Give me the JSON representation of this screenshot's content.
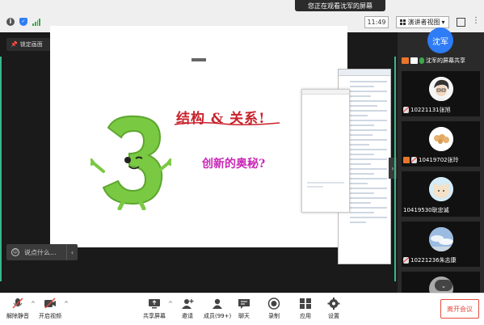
{
  "topbar": {
    "banner": "您正在观看沈军的屏幕",
    "time": "11:49",
    "view_label": "演讲者视图",
    "view_caret": "▾",
    "more": "⋮"
  },
  "main": {
    "pin_label": "锁定画面",
    "slide": {
      "title1": "结构 & 关系!",
      "title2": "创新的奥秘?"
    },
    "chat_placeholder": "说点什么...",
    "chat_arrow": "‹",
    "collapse_arrow": "›"
  },
  "participants": {
    "host_avatar_text": "沈军",
    "share_label": "沈军的屏幕共享",
    "tiles": [
      {
        "name": "10221131张旭"
      },
      {
        "name": "10419702张玲"
      },
      {
        "name": "10419530耿忠诚"
      },
      {
        "name": "10221236朱志康"
      }
    ],
    "scroll_down": "⌄"
  },
  "toolbar": {
    "mute": "解除静音",
    "video": "开启视频",
    "share": "共享屏幕",
    "invite": "邀请",
    "members": "成员(99+)",
    "chat": "聊天",
    "record": "录制",
    "apps": "应用",
    "settings": "设置",
    "leave": "离开会议",
    "caret": "^"
  },
  "colors": {
    "accent_blue": "#2e7cf6",
    "leave_red": "#e34b3f",
    "active_teal": "#37b88b",
    "number_green": "#7ac943"
  }
}
